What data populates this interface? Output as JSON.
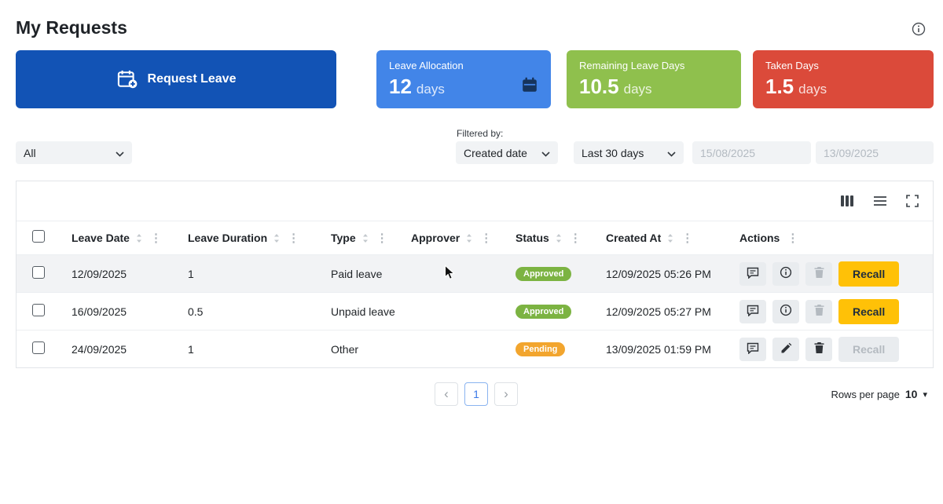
{
  "page": {
    "title": "My Requests"
  },
  "request_leave": {
    "label": "Request Leave",
    "color": "#1253b5"
  },
  "cards": [
    {
      "label": "Leave Allocation",
      "value": "12",
      "unit": "days",
      "color": "#4285e8",
      "icon": "calendar-icon"
    },
    {
      "label": "Remaining Leave Days",
      "value": "10.5",
      "unit": "days",
      "color": "#8fc04d"
    },
    {
      "label": "Taken Days",
      "value": "1.5",
      "unit": "days",
      "color": "#db4a3a"
    }
  ],
  "filters": {
    "type_value": "All",
    "filtered_by_label": "Filtered by:",
    "field_value": "Created date",
    "range_value": "Last 30 days",
    "date_from": "15/08/2025",
    "date_to": "13/09/2025"
  },
  "table": {
    "columns": [
      "Leave Date",
      "Leave Duration",
      "Type",
      "Approver",
      "Status",
      "Created At",
      "Actions"
    ],
    "rows": [
      {
        "leave_date": "12/09/2025",
        "leave_duration": "1",
        "type": "Paid leave",
        "status": "Approved",
        "created_at": "12/09/2025 05:26 PM"
      },
      {
        "leave_date": "16/09/2025",
        "leave_duration": "0.5",
        "type": "Unpaid leave",
        "status": "Approved",
        "created_at": "12/09/2025 05:27 PM"
      },
      {
        "leave_date": "24/09/2025",
        "leave_duration": "1",
        "type": "Other",
        "status": "Pending",
        "created_at": "13/09/2025 01:59 PM"
      }
    ],
    "recall_label": "Recall"
  },
  "status_colors": {
    "approved": "#7cb342",
    "pending": "#f2a52e"
  },
  "pagination": {
    "prev_icon": "‹",
    "page": "1",
    "next_icon": "›",
    "rows_per_page_label": "Rows per page",
    "rows_per_page_value": "10",
    "caret_icon": "▾"
  }
}
